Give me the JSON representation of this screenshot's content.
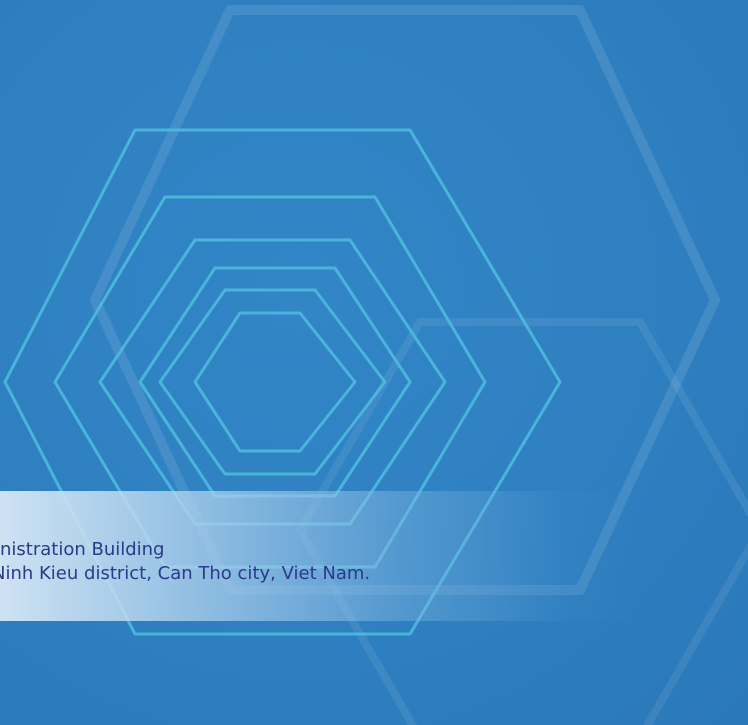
{
  "slide": {
    "address_line_1": "Administration Building",
    "address_line_2": "Ninh Kieu district, Can Tho city, Viet Nam.",
    "colors": {
      "background": "#2e7fc0",
      "text": "#2a3a8c"
    }
  }
}
